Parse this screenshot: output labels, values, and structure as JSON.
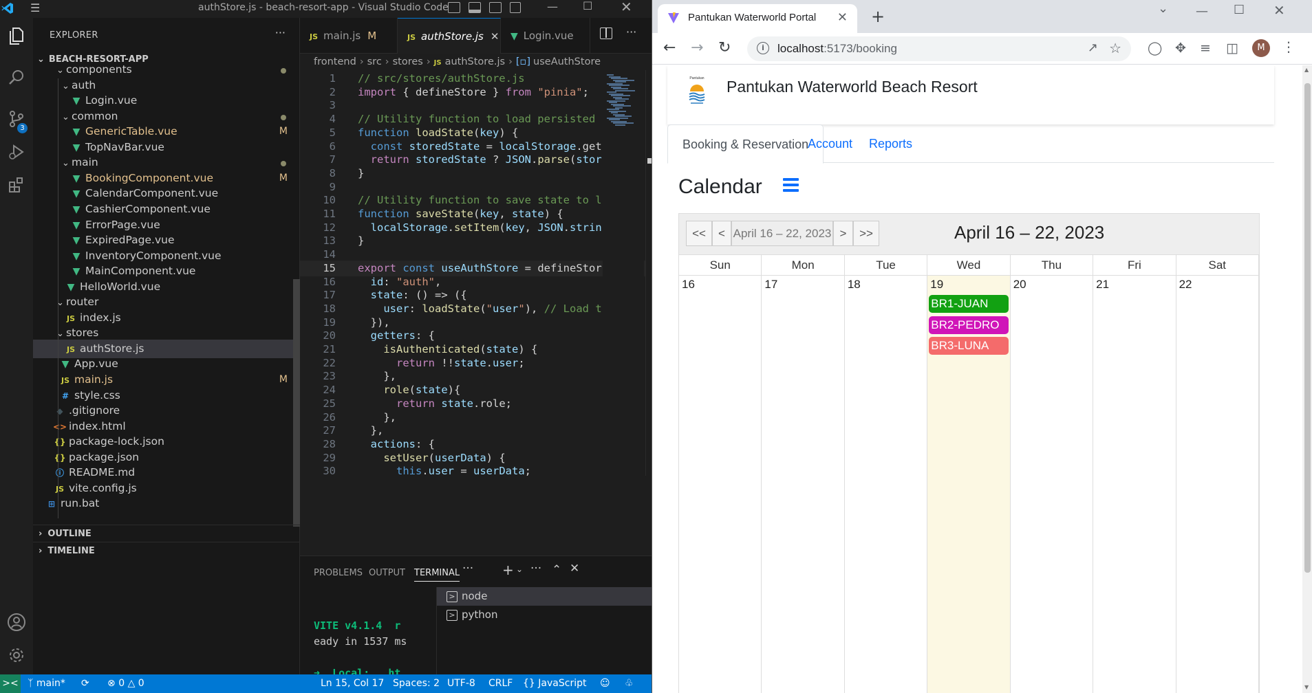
{
  "vscode": {
    "window_title": "authStore.js - beach-resort-app - Visual Studio Code",
    "explorer": {
      "header": "EXPLORER",
      "project": "BEACH-RESORT-APP",
      "rows": [
        {
          "label": "components",
          "kind": "folder",
          "depth": 1,
          "status": "dot"
        },
        {
          "label": "auth",
          "kind": "folder",
          "depth": 2
        },
        {
          "label": "Login.vue",
          "kind": "vue",
          "depth": 3
        },
        {
          "label": "common",
          "kind": "folder",
          "depth": 2,
          "status": "dot"
        },
        {
          "label": "GenericTable.vue",
          "kind": "vue",
          "depth": 3,
          "status": "M"
        },
        {
          "label": "TopNavBar.vue",
          "kind": "vue",
          "depth": 3
        },
        {
          "label": "main",
          "kind": "folder",
          "depth": 2,
          "status": "dot"
        },
        {
          "label": "BookingComponent.vue",
          "kind": "vue",
          "depth": 3,
          "status": "M"
        },
        {
          "label": "CalendarComponent.vue",
          "kind": "vue",
          "depth": 3
        },
        {
          "label": "CashierComponent.vue",
          "kind": "vue",
          "depth": 3
        },
        {
          "label": "ErrorPage.vue",
          "kind": "vue",
          "depth": 3
        },
        {
          "label": "ExpiredPage.vue",
          "kind": "vue",
          "depth": 3
        },
        {
          "label": "InventoryComponent.vue",
          "kind": "vue",
          "depth": 3
        },
        {
          "label": "MainComponent.vue",
          "kind": "vue",
          "depth": 3
        },
        {
          "label": "HelloWorld.vue",
          "kind": "vue",
          "depth": 2
        },
        {
          "label": "router",
          "kind": "folder",
          "depth": 1
        },
        {
          "label": "index.js",
          "kind": "js",
          "depth": 2
        },
        {
          "label": "stores",
          "kind": "folder",
          "depth": 1
        },
        {
          "label": "authStore.js",
          "kind": "js",
          "depth": 2,
          "selected": true
        },
        {
          "label": "App.vue",
          "kind": "vue",
          "depth": 1
        },
        {
          "label": "main.js",
          "kind": "js",
          "depth": 1,
          "status": "M"
        },
        {
          "label": "style.css",
          "kind": "css",
          "depth": 1
        },
        {
          "label": ".gitignore",
          "kind": "git",
          "depth": 0
        },
        {
          "label": "index.html",
          "kind": "html",
          "depth": 0
        },
        {
          "label": "package-lock.json",
          "kind": "json",
          "depth": 0
        },
        {
          "label": "package.json",
          "kind": "json",
          "depth": 0
        },
        {
          "label": "README.md",
          "kind": "md",
          "depth": 0
        },
        {
          "label": "vite.config.js",
          "kind": "js",
          "depth": 0
        },
        {
          "label": "run.bat",
          "kind": "bat",
          "depth": -1
        }
      ],
      "outline": "OUTLINE",
      "timeline": "TIMELINE"
    },
    "tabs": [
      {
        "label": "main.js",
        "icon": "JS",
        "status": "M"
      },
      {
        "label": "authStore.js",
        "icon": "JS",
        "active": true
      },
      {
        "label": "Login.vue",
        "icon": "V"
      }
    ],
    "breadcrumb": [
      "frontend",
      "src",
      "stores",
      "authStore.js",
      "useAuthStore"
    ],
    "code_lines": [
      "// src/stores/authStore.js",
      "import { defineStore } from \"pinia\";",
      "",
      "// Utility function to load persisted",
      "function loadState(key) {",
      "  const storedState = localStorage.get",
      "  return storedState ? JSON.parse(stor",
      "}",
      "",
      "// Utility function to save state to l",
      "function saveState(key, state) {",
      "  localStorage.setItem(key, JSON.strin",
      "}",
      "",
      "export const useAuthStore = defineStor",
      "  id: \"auth\",",
      "  state: () => ({",
      "    user: loadState(\"user\"), // Load t",
      "  }),",
      "  getters: {",
      "    isAuthenticated(state) {",
      "      return !!state.user;",
      "    },",
      "    role(state){",
      "      return state.role;",
      "    },",
      "  },",
      "  actions: {",
      "    setUser(userData) {",
      "      this.user = userData;"
    ],
    "current_line": 15,
    "panel": {
      "tabs": [
        "PROBLEMS",
        "OUTPUT",
        "TERMINAL"
      ],
      "active_tab": "TERMINAL",
      "terminal_lines": [
        "VITE v4.1.4  r",
        "eady in 1537 ms",
        "",
        "➜  Local:   ht"
      ],
      "terminals": [
        "node",
        "python"
      ]
    },
    "status": {
      "branch": "main*",
      "errors": "0",
      "warnings": "0",
      "position": "Ln 15, Col 17",
      "spaces": "Spaces: 2",
      "encoding": "UTF-8",
      "eol": "CRLF",
      "language": "JavaScript"
    },
    "scm_badge": "3"
  },
  "chrome": {
    "tab_title": "Pantukan Waterworld Portal",
    "url_host": "localhost",
    "url_path": ":5173/booking",
    "avatar_letter": "M"
  },
  "site": {
    "title": "Pantukan Waterworld Beach Resort",
    "logo_text": "Pantukan",
    "nav": [
      "Booking & Reservation",
      "Account",
      "Reports"
    ],
    "active_nav": 0,
    "calendar_heading": "Calendar",
    "calendar": {
      "buttons": [
        "<<",
        "<",
        ">",
        ">>"
      ],
      "range_button": "April 16 – 22, 2023",
      "range_title": "April 16 – 22, 2023",
      "days": [
        {
          "dow": "Sun",
          "num": "16"
        },
        {
          "dow": "Mon",
          "num": "17"
        },
        {
          "dow": "Tue",
          "num": "18"
        },
        {
          "dow": "Wed",
          "num": "19",
          "today": true
        },
        {
          "dow": "Thu",
          "num": "20"
        },
        {
          "dow": "Fri",
          "num": "21"
        },
        {
          "dow": "Sat",
          "num": "22"
        }
      ],
      "events": [
        {
          "label": "BR1-JUAN",
          "day": 3,
          "color": "#12a112"
        },
        {
          "label": "BR2-PEDRO",
          "day": 3,
          "color": "#d015b8"
        },
        {
          "label": "BR3-LUNA",
          "day": 3,
          "color": "#f46b6b"
        }
      ]
    }
  },
  "colors": {
    "vscode_accent": "#0078d4",
    "link_blue": "#0d6efd",
    "today_bg": "#fcf8e3"
  }
}
